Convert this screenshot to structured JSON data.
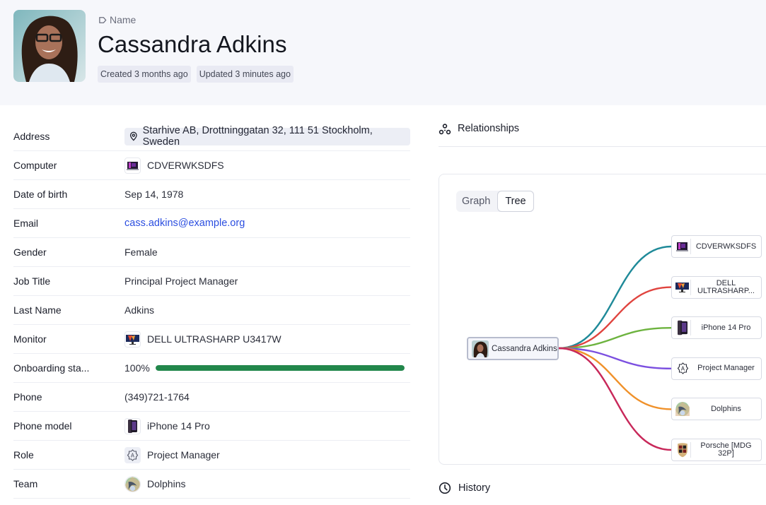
{
  "header": {
    "name_label": "Name",
    "title": "Cassandra Adkins",
    "badges": {
      "created": "Created 3 months ago",
      "updated": "Updated 3 minutes ago"
    },
    "avatar_icon": "person-photo"
  },
  "fields": [
    {
      "label": "Address",
      "value": "Starhive AB, Drottninggatan 32, 111 51 Stockholm, Sweden",
      "icon": "map-pin-icon"
    },
    {
      "label": "Computer",
      "value": "CDVERWKSDFS",
      "icon": "laptop-thumbnail"
    },
    {
      "label": "Date of birth",
      "value": "Sep 14, 1978"
    },
    {
      "label": "Email",
      "value": "cass.adkins@example.org"
    },
    {
      "label": "Gender",
      "value": "Female"
    },
    {
      "label": "Job Title",
      "value": "Principal Project Manager"
    },
    {
      "label": "Last Name",
      "value": "Adkins"
    },
    {
      "label": "Monitor",
      "value": "DELL ULTRASHARP U3417W",
      "icon": "monitor-thumbnail"
    },
    {
      "label": "Onboarding sta...",
      "value": "100%",
      "progress": 1.0,
      "color": "#22874b"
    },
    {
      "label": "Phone",
      "value": "(349)721-1764"
    },
    {
      "label": "Phone model",
      "value": "iPhone 14 Pro",
      "icon": "phone-thumbnail"
    },
    {
      "label": "Role",
      "value": "Project Manager",
      "icon": "role-badge-icon"
    },
    {
      "label": "Team",
      "value": "Dolphins",
      "icon": "dolphin-thumbnail"
    }
  ],
  "relationships": {
    "title": "Relationships",
    "icon": "relationships-icon",
    "tabs": [
      {
        "label": "Graph",
        "active": false
      },
      {
        "label": "Tree",
        "active": true
      }
    ],
    "root": {
      "label": "Cassandra Adkins"
    },
    "nodes": [
      {
        "label": "CDVERWKSDFS",
        "color": "#1f8a99",
        "icon": "laptop-thumbnail"
      },
      {
        "label": "DELL ULTRASHARP...",
        "color": "#e0443f",
        "icon": "monitor-thumbnail"
      },
      {
        "label": "iPhone 14 Pro",
        "color": "#6db33f",
        "icon": "phone-thumbnail"
      },
      {
        "label": "Project Manager",
        "color": "#7b4fe0",
        "icon": "role-badge-icon"
      },
      {
        "label": "Dolphins",
        "color": "#f0912a",
        "icon": "dolphin-thumbnail"
      },
      {
        "label": "Porsche [MDG 32P]",
        "color": "#c8285a",
        "icon": "porsche-crest-thumbnail"
      }
    ]
  },
  "history": {
    "title": "History",
    "icon": "clock-icon"
  }
}
